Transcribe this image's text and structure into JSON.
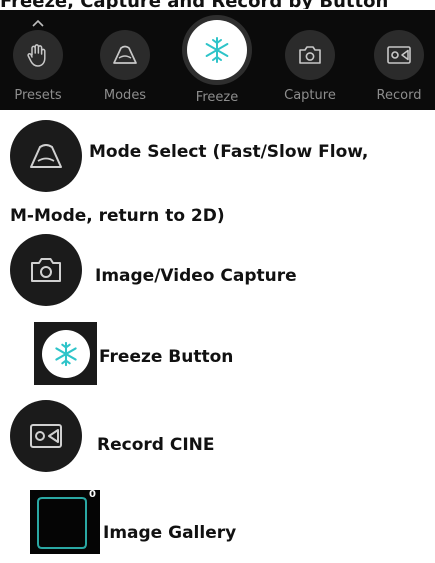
{
  "header_cut_text": "Freeze, Capture and Record by Button",
  "toolbar": {
    "items": [
      {
        "label": "Presets",
        "icon": "hand-icon"
      },
      {
        "label": "Modes",
        "icon": "ultrasound-probe-icon"
      },
      {
        "label": "Freeze",
        "icon": "snowflake-icon"
      },
      {
        "label": "Capture",
        "icon": "camera-icon"
      },
      {
        "label": "Record",
        "icon": "video-camera-icon"
      }
    ]
  },
  "legend": {
    "mode_select_line1": "Mode Select (Fast/Slow Flow,",
    "mode_select_line2": "M-Mode, return to 2D)",
    "capture": "Image/Video Capture",
    "freeze": "Freeze Button",
    "record": "Record CINE",
    "gallery": "Image Gallery",
    "gallery_count": "0"
  },
  "colors": {
    "toolbar_bg": "#0b0b0b",
    "button_bg": "#2b2b2b",
    "freeze_accent": "#2ec4c9",
    "icon_gray": "#c8c8c8",
    "gallery_accent": "#2aa8a4"
  }
}
